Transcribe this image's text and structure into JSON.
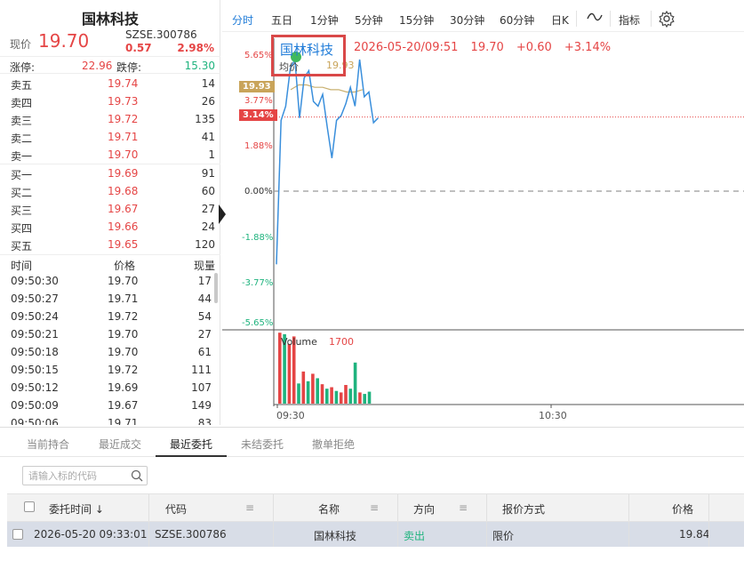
{
  "stock": {
    "name": "国林科技",
    "price_label": "现价",
    "price": "19.70",
    "code": "SZSE.300786",
    "change": "0.57",
    "change_pct": "2.98%",
    "limit_up_label": "涨停:",
    "limit_up": "22.96",
    "limit_down_label": "跌停:",
    "limit_down": "15.30"
  },
  "order_book": {
    "asks": [
      {
        "label": "卖五",
        "price": "19.74",
        "volume": "14"
      },
      {
        "label": "卖四",
        "price": "19.73",
        "volume": "26"
      },
      {
        "label": "卖三",
        "price": "19.72",
        "volume": "135"
      },
      {
        "label": "卖二",
        "price": "19.71",
        "volume": "41"
      },
      {
        "label": "卖一",
        "price": "19.70",
        "volume": "1"
      }
    ],
    "bids": [
      {
        "label": "买一",
        "price": "19.69",
        "volume": "91"
      },
      {
        "label": "买二",
        "price": "19.68",
        "volume": "60"
      },
      {
        "label": "买三",
        "price": "19.67",
        "volume": "27"
      },
      {
        "label": "买四",
        "price": "19.66",
        "volume": "24"
      },
      {
        "label": "买五",
        "price": "19.65",
        "volume": "120"
      }
    ]
  },
  "ticks": {
    "headers": [
      "时间",
      "价格",
      "现量"
    ],
    "rows": [
      {
        "time": "09:50:30",
        "price": "19.70",
        "volume": "17"
      },
      {
        "time": "09:50:27",
        "price": "19.71",
        "volume": "44"
      },
      {
        "time": "09:50:24",
        "price": "19.72",
        "volume": "54"
      },
      {
        "time": "09:50:21",
        "price": "19.70",
        "volume": "27"
      },
      {
        "time": "09:50:18",
        "price": "19.70",
        "volume": "61"
      },
      {
        "time": "09:50:15",
        "price": "19.72",
        "volume": "111"
      },
      {
        "time": "09:50:12",
        "price": "19.69",
        "volume": "107"
      },
      {
        "time": "09:50:09",
        "price": "19.67",
        "volume": "149"
      },
      {
        "time": "09:50:06",
        "price": "19.71",
        "volume": "83"
      }
    ]
  },
  "toolbar": {
    "periods": [
      "分时",
      "五日",
      "1分钟",
      "5分钟",
      "15分钟",
      "30分钟",
      "60分钟",
      "日K"
    ],
    "active": "分时",
    "indicator_label": "指标"
  },
  "chart": {
    "title": "国林科技",
    "datetime": "2026-05-20/09:51",
    "price": "19.70",
    "change": "+0.60",
    "change_pct": "+3.14%",
    "avg_label": "均价",
    "avg_value": "19.93",
    "badge_price": "19.93",
    "badge_pct_upper": "3.77%",
    "badge_pct": "3.14%",
    "volume_label": "Volume",
    "volume_value": "1700",
    "x_labels": [
      "09:30",
      "10:30"
    ]
  },
  "chart_data": {
    "type": "line",
    "title": "国林科技",
    "y_pct_ticks": [
      "5.65%",
      "3.77%",
      "1.88%",
      "0.00%",
      "-1.88%",
      "-3.77%",
      "-5.65%"
    ],
    "ylim_pct": [
      -5.65,
      5.65
    ],
    "x_ticks": [
      "09:30",
      "10:30"
    ],
    "series": [
      {
        "values_pct": [
          -3.1,
          3.0,
          3.6,
          5.2,
          6.6,
          3.1,
          4.8,
          5.1,
          3.8,
          3.6,
          4.1,
          2.7,
          1.4,
          3.0,
          3.2,
          3.7,
          4.4,
          3.6,
          5.9,
          4.0,
          4.2,
          2.9,
          3.1
        ]
      },
      {
        "values_pct": [
          4.3,
          4.5,
          4.5,
          4.4,
          4.4,
          4.3,
          4.3,
          4.2,
          4.2,
          4.3
        ]
      }
    ],
    "volume": {
      "values": [
        95,
        93,
        80,
        90,
        27,
        43,
        30,
        40,
        34,
        26,
        20,
        22,
        17,
        15,
        25,
        20,
        55,
        15,
        13,
        16
      ],
      "directions": [
        "down",
        "up",
        "down",
        "down",
        "up",
        "down",
        "up",
        "down",
        "up",
        "down",
        "up",
        "down",
        "up",
        "down",
        "down",
        "up",
        "up",
        "down",
        "up",
        "up"
      ]
    },
    "colors": {
      "up": "#e54545",
      "down": "#1fb37e",
      "price": "#3a8fdc",
      "avg": "#c9b070",
      "ref": "#e54545"
    }
  },
  "bottom": {
    "tabs": [
      "当前持合",
      "最近成交",
      "最近委托",
      "未结委托",
      "撤单拒绝"
    ],
    "active_tab": "最近委托",
    "search_placeholder": "请输入标的代码",
    "columns": [
      "委托时间 ↓",
      "代码",
      "名称",
      "方向",
      "报价方式",
      "价格"
    ],
    "rows": [
      {
        "time": "2026-05-20 09:33:01",
        "code": "SZSE.300786",
        "name": "国林科技",
        "direction": "卖出",
        "quote_type": "限价",
        "price": "19.84"
      }
    ]
  }
}
